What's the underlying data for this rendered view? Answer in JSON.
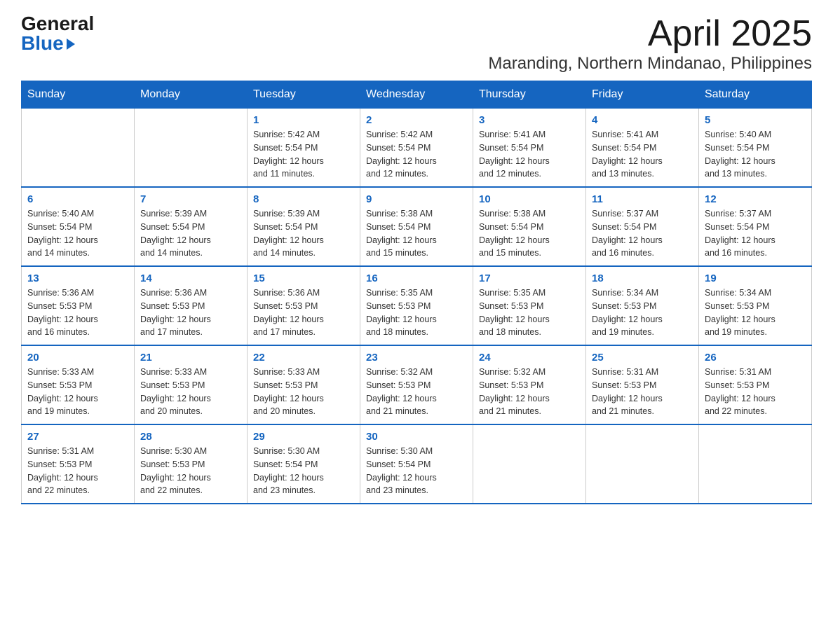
{
  "logo": {
    "general": "General",
    "blue": "Blue"
  },
  "title": "April 2025",
  "subtitle": "Maranding, Northern Mindanao, Philippines",
  "days_of_week": [
    "Sunday",
    "Monday",
    "Tuesday",
    "Wednesday",
    "Thursday",
    "Friday",
    "Saturday"
  ],
  "weeks": [
    [
      {
        "day": "",
        "info": ""
      },
      {
        "day": "",
        "info": ""
      },
      {
        "day": "1",
        "info": "Sunrise: 5:42 AM\nSunset: 5:54 PM\nDaylight: 12 hours\nand 11 minutes."
      },
      {
        "day": "2",
        "info": "Sunrise: 5:42 AM\nSunset: 5:54 PM\nDaylight: 12 hours\nand 12 minutes."
      },
      {
        "day": "3",
        "info": "Sunrise: 5:41 AM\nSunset: 5:54 PM\nDaylight: 12 hours\nand 12 minutes."
      },
      {
        "day": "4",
        "info": "Sunrise: 5:41 AM\nSunset: 5:54 PM\nDaylight: 12 hours\nand 13 minutes."
      },
      {
        "day": "5",
        "info": "Sunrise: 5:40 AM\nSunset: 5:54 PM\nDaylight: 12 hours\nand 13 minutes."
      }
    ],
    [
      {
        "day": "6",
        "info": "Sunrise: 5:40 AM\nSunset: 5:54 PM\nDaylight: 12 hours\nand 14 minutes."
      },
      {
        "day": "7",
        "info": "Sunrise: 5:39 AM\nSunset: 5:54 PM\nDaylight: 12 hours\nand 14 minutes."
      },
      {
        "day": "8",
        "info": "Sunrise: 5:39 AM\nSunset: 5:54 PM\nDaylight: 12 hours\nand 14 minutes."
      },
      {
        "day": "9",
        "info": "Sunrise: 5:38 AM\nSunset: 5:54 PM\nDaylight: 12 hours\nand 15 minutes."
      },
      {
        "day": "10",
        "info": "Sunrise: 5:38 AM\nSunset: 5:54 PM\nDaylight: 12 hours\nand 15 minutes."
      },
      {
        "day": "11",
        "info": "Sunrise: 5:37 AM\nSunset: 5:54 PM\nDaylight: 12 hours\nand 16 minutes."
      },
      {
        "day": "12",
        "info": "Sunrise: 5:37 AM\nSunset: 5:54 PM\nDaylight: 12 hours\nand 16 minutes."
      }
    ],
    [
      {
        "day": "13",
        "info": "Sunrise: 5:36 AM\nSunset: 5:53 PM\nDaylight: 12 hours\nand 16 minutes."
      },
      {
        "day": "14",
        "info": "Sunrise: 5:36 AM\nSunset: 5:53 PM\nDaylight: 12 hours\nand 17 minutes."
      },
      {
        "day": "15",
        "info": "Sunrise: 5:36 AM\nSunset: 5:53 PM\nDaylight: 12 hours\nand 17 minutes."
      },
      {
        "day": "16",
        "info": "Sunrise: 5:35 AM\nSunset: 5:53 PM\nDaylight: 12 hours\nand 18 minutes."
      },
      {
        "day": "17",
        "info": "Sunrise: 5:35 AM\nSunset: 5:53 PM\nDaylight: 12 hours\nand 18 minutes."
      },
      {
        "day": "18",
        "info": "Sunrise: 5:34 AM\nSunset: 5:53 PM\nDaylight: 12 hours\nand 19 minutes."
      },
      {
        "day": "19",
        "info": "Sunrise: 5:34 AM\nSunset: 5:53 PM\nDaylight: 12 hours\nand 19 minutes."
      }
    ],
    [
      {
        "day": "20",
        "info": "Sunrise: 5:33 AM\nSunset: 5:53 PM\nDaylight: 12 hours\nand 19 minutes."
      },
      {
        "day": "21",
        "info": "Sunrise: 5:33 AM\nSunset: 5:53 PM\nDaylight: 12 hours\nand 20 minutes."
      },
      {
        "day": "22",
        "info": "Sunrise: 5:33 AM\nSunset: 5:53 PM\nDaylight: 12 hours\nand 20 minutes."
      },
      {
        "day": "23",
        "info": "Sunrise: 5:32 AM\nSunset: 5:53 PM\nDaylight: 12 hours\nand 21 minutes."
      },
      {
        "day": "24",
        "info": "Sunrise: 5:32 AM\nSunset: 5:53 PM\nDaylight: 12 hours\nand 21 minutes."
      },
      {
        "day": "25",
        "info": "Sunrise: 5:31 AM\nSunset: 5:53 PM\nDaylight: 12 hours\nand 21 minutes."
      },
      {
        "day": "26",
        "info": "Sunrise: 5:31 AM\nSunset: 5:53 PM\nDaylight: 12 hours\nand 22 minutes."
      }
    ],
    [
      {
        "day": "27",
        "info": "Sunrise: 5:31 AM\nSunset: 5:53 PM\nDaylight: 12 hours\nand 22 minutes."
      },
      {
        "day": "28",
        "info": "Sunrise: 5:30 AM\nSunset: 5:53 PM\nDaylight: 12 hours\nand 22 minutes."
      },
      {
        "day": "29",
        "info": "Sunrise: 5:30 AM\nSunset: 5:54 PM\nDaylight: 12 hours\nand 23 minutes."
      },
      {
        "day": "30",
        "info": "Sunrise: 5:30 AM\nSunset: 5:54 PM\nDaylight: 12 hours\nand 23 minutes."
      },
      {
        "day": "",
        "info": ""
      },
      {
        "day": "",
        "info": ""
      },
      {
        "day": "",
        "info": ""
      }
    ]
  ]
}
